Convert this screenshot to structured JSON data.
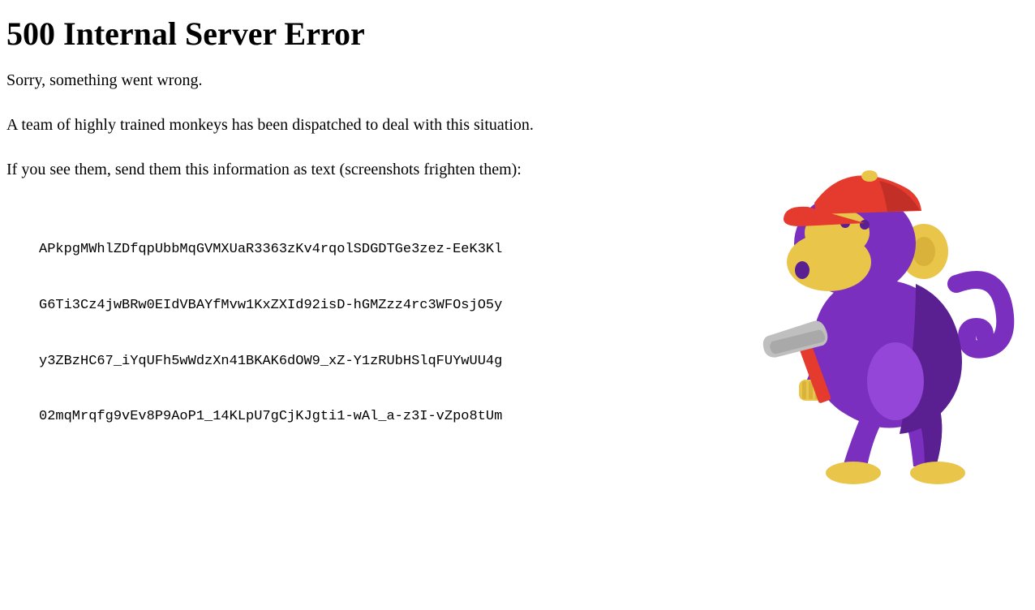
{
  "heading": "500 Internal Server Error",
  "paragraphs": [
    "Sorry, something went wrong.",
    "A team of highly trained monkeys has been dispatched to deal with this situation.",
    "If you see them, send them this information as text (screenshots frighten them):"
  ],
  "error_code_lines": [
    "APkpgMWhlZDfqpUbbMqGVMXUaR3363zKv4rqolSDGDTGe3zez-EeK3Kl",
    "G6Ti3Cz4jwBRw0EIdVBAYfMvw1KxZXId92isD-hGMZzz4rc3WFOsjO5y",
    "y3ZBzHC67_iYqUFh5wWdzXn41BKAK6dOW9_xZ-Y1zRUbHSlqFUYwUU4g",
    "02mqMrqfg9vEv8P9AoP1_14KLpU7gCjKJgti1-wAl_a-z3I-vZpo8tUm"
  ],
  "image": {
    "alt": "Purple cartoon monkey wearing a red cap and holding a hammer"
  }
}
